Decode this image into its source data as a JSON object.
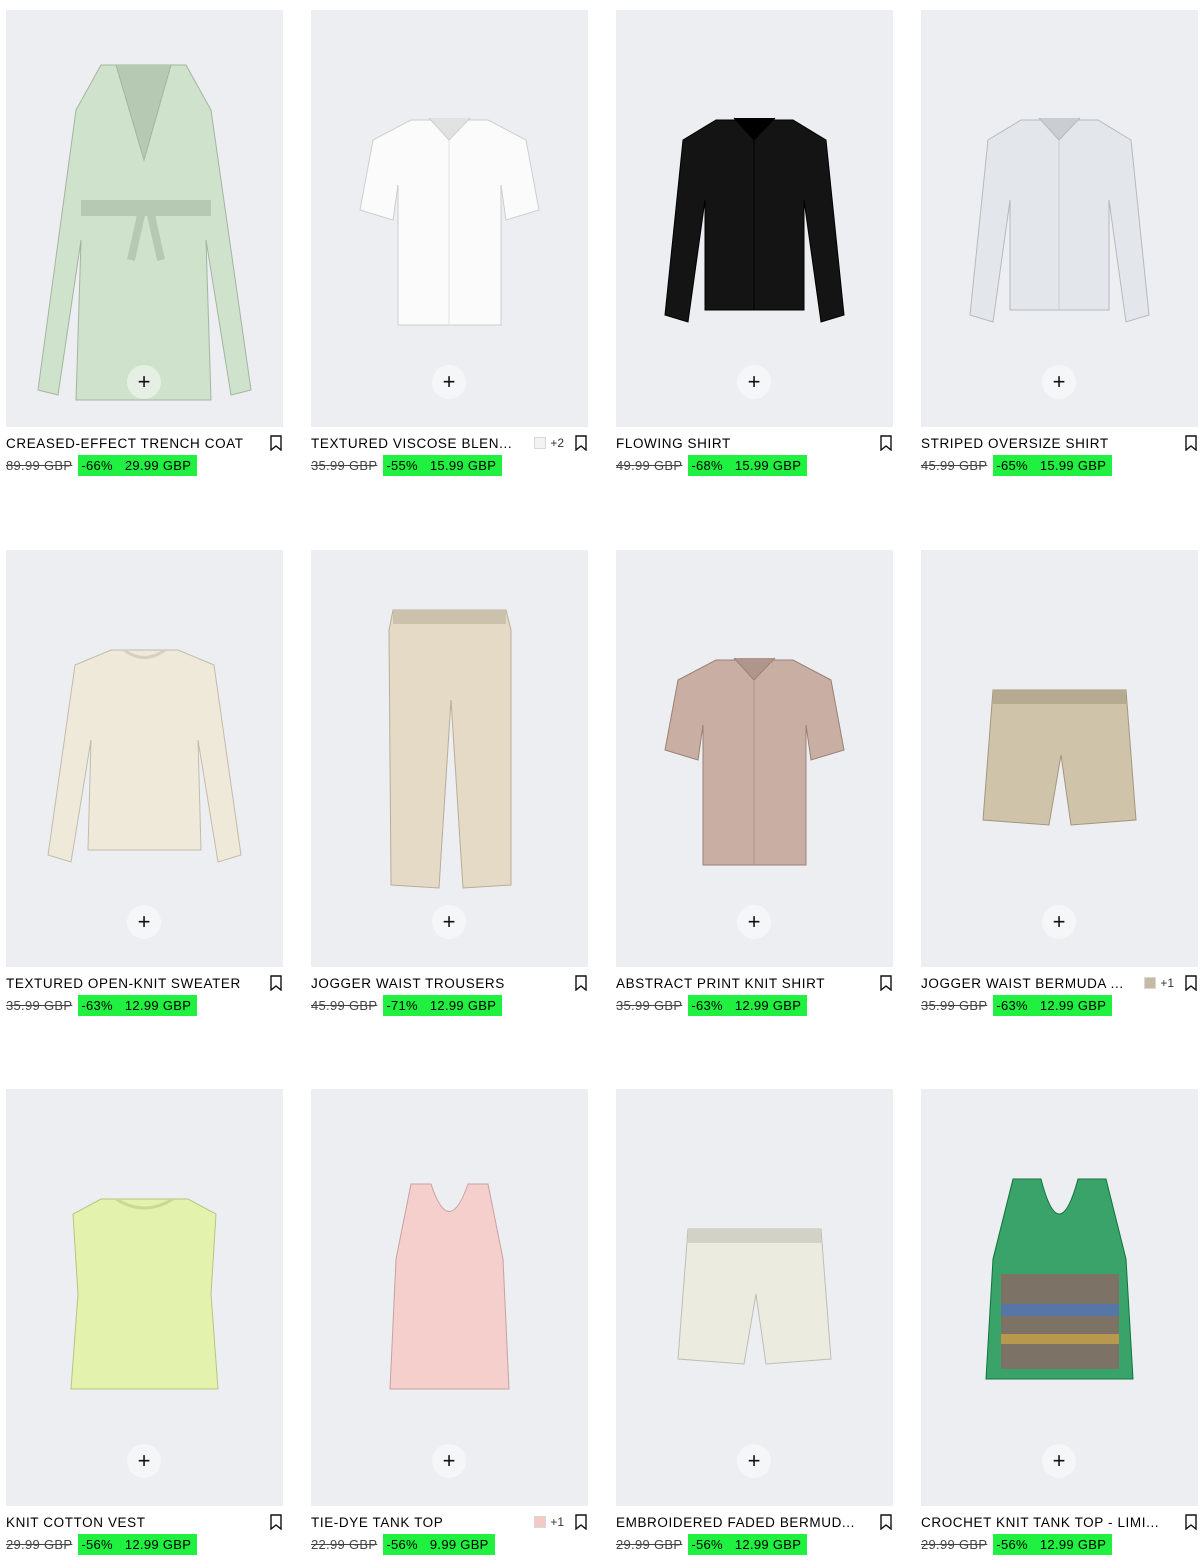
{
  "products": [
    {
      "name": "CREASED-EFFECT TRENCH COAT",
      "old_price": "89.99 GBP",
      "discount": "-66%",
      "price": "29.99 GBP",
      "extra": "",
      "swatch": "",
      "garment": "coat",
      "color": "#cfe2cc"
    },
    {
      "name": "TEXTURED VISCOSE BLEN...",
      "old_price": "35.99 GBP",
      "discount": "-55%",
      "price": "15.99 GBP",
      "extra": "+2",
      "swatch": "#f3f3f3",
      "garment": "shortshirt",
      "color": "#fbfbfb"
    },
    {
      "name": "FLOWING SHIRT",
      "old_price": "49.99 GBP",
      "discount": "-68%",
      "price": "15.99 GBP",
      "extra": "",
      "swatch": "",
      "garment": "longshirt",
      "color": "#141414"
    },
    {
      "name": "STRIPED OVERSIZE SHIRT",
      "old_price": "45.99 GBP",
      "discount": "-65%",
      "price": "15.99 GBP",
      "extra": "",
      "swatch": "",
      "garment": "longshirt",
      "color": "#e3e6ea"
    },
    {
      "name": "TEXTURED OPEN-KNIT SWEATER",
      "old_price": "35.99 GBP",
      "discount": "-63%",
      "price": "12.99 GBP",
      "extra": "",
      "swatch": "",
      "garment": "sweater",
      "color": "#efe9d9"
    },
    {
      "name": "JOGGER WAIST TROUSERS",
      "old_price": "45.99 GBP",
      "discount": "-71%",
      "price": "12.99 GBP",
      "extra": "",
      "swatch": "",
      "garment": "trousers",
      "color": "#e4dac6"
    },
    {
      "name": "ABSTRACT PRINT KNIT SHIRT",
      "old_price": "35.99 GBP",
      "discount": "-63%",
      "price": "12.99 GBP",
      "extra": "",
      "swatch": "",
      "garment": "shortshirt",
      "color": "#c9aea3"
    },
    {
      "name": "JOGGER WAIST BERMUDA ...",
      "old_price": "35.99 GBP",
      "discount": "-63%",
      "price": "12.99 GBP",
      "extra": "+1",
      "swatch": "#c4bba2",
      "garment": "shorts",
      "color": "#cfc4aa"
    },
    {
      "name": "KNIT COTTON VEST",
      "old_price": "29.99 GBP",
      "discount": "-56%",
      "price": "12.99 GBP",
      "extra": "",
      "swatch": "",
      "garment": "vest",
      "color": "#e3f2ad"
    },
    {
      "name": "TIE-DYE TANK TOP",
      "old_price": "22.99 GBP",
      "discount": "-56%",
      "price": "9.99 GBP",
      "extra": "+1",
      "swatch": "#f3c9c6",
      "garment": "tank",
      "color": "#f4cfcb"
    },
    {
      "name": "EMBROIDERED FADED BERMUD...",
      "old_price": "29.99 GBP",
      "discount": "-56%",
      "price": "12.99 GBP",
      "extra": "",
      "swatch": "",
      "garment": "shorts",
      "color": "#ecebdf"
    },
    {
      "name": "CROCHET KNIT TANK TOP - LIMI...",
      "old_price": "29.99 GBP",
      "discount": "-56%",
      "price": "12.99 GBP",
      "extra": "",
      "swatch": "",
      "garment": "crochet",
      "color": "#3aa36a"
    }
  ],
  "add_label": "+",
  "sale_color": "#20f03f"
}
